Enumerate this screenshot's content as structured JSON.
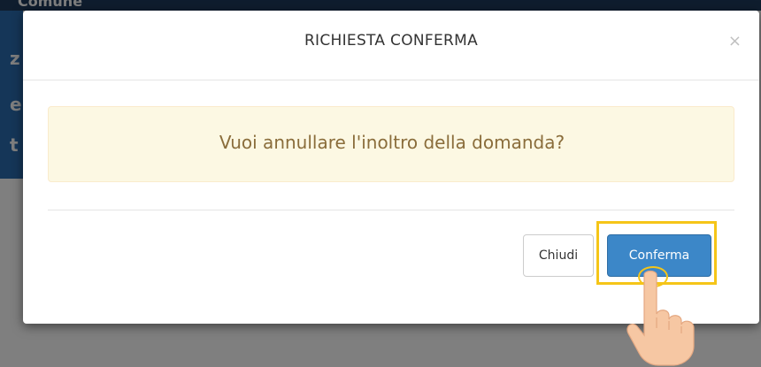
{
  "background": {
    "topbar_text": "Comune",
    "sidebar_letters": [
      "z",
      "e",
      "t"
    ]
  },
  "modal": {
    "title": "RICHIESTA CONFERMA",
    "close_symbol": "×",
    "message": "Vuoi annullare l'inoltro della domanda?",
    "buttons": {
      "close_label": "Chiudi",
      "confirm_label": "Conferma"
    }
  },
  "colors": {
    "overlay": "#000000",
    "alert_bg": "#fcf8e3",
    "alert_text": "#8a6d3b",
    "primary_button": "#3c87c8",
    "highlight": "#f5c518"
  },
  "icons": {
    "close": "close-icon",
    "pointer": "hand-pointer-icon"
  }
}
